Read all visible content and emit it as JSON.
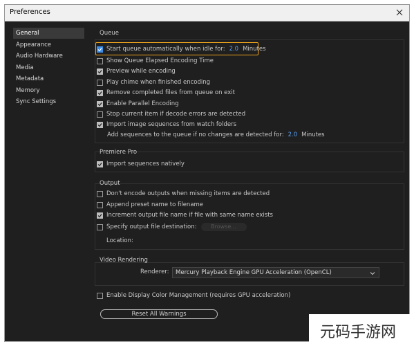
{
  "window": {
    "title": "Preferences"
  },
  "sidebar": {
    "items": [
      {
        "label": "General"
      },
      {
        "label": "Appearance"
      },
      {
        "label": "Audio Hardware"
      },
      {
        "label": "Media"
      },
      {
        "label": "Metadata"
      },
      {
        "label": "Memory"
      },
      {
        "label": "Sync Settings"
      }
    ],
    "selected": "General"
  },
  "queue": {
    "title": "Queue",
    "auto_start_label": "Start queue automatically when idle for:",
    "auto_start_value": "2.0",
    "auto_start_unit": "Minutes",
    "show_elapsed_label": "Show Queue Elapsed Encoding Time",
    "preview_label": "Preview while encoding",
    "chime_label": "Play chime when finished encoding",
    "remove_completed_label": "Remove completed files from queue on exit",
    "parallel_label": "Enable Parallel Encoding",
    "stop_on_error_label": "Stop current item if decode errors are detected",
    "import_watch_label": "Import image sequences from watch folders",
    "add_sequences_label": "Add sequences to the queue if no changes are detected for:",
    "add_sequences_value": "2.0",
    "add_sequences_unit": "Minutes"
  },
  "premiere": {
    "title": "Premiere Pro",
    "import_native_label": "Import sequences natively"
  },
  "output": {
    "title": "Output",
    "dont_encode_label": "Don't encode outputs when missing items are detected",
    "append_preset_label": "Append preset name to filename",
    "increment_label": "Increment output file name if file with same name exists",
    "specify_dest_label": "Specify output file destination:",
    "browse_label": "Browse...",
    "location_label": "Location:"
  },
  "video_rendering": {
    "title": "Video Rendering",
    "renderer_label": "Renderer:",
    "renderer_value": "Mercury Playback Engine GPU Acceleration (OpenCL)"
  },
  "display_color": {
    "label": "Enable Display Color Management (requires GPU acceleration)"
  },
  "reset_warnings": {
    "label": "Reset All Warnings"
  },
  "watermark": {
    "text": "元码手游网"
  },
  "colors": {
    "background": "#1f1f1f",
    "accent": "#3d8ee8",
    "highlight": "#f0a51c",
    "value_text": "#5aa0f0"
  }
}
